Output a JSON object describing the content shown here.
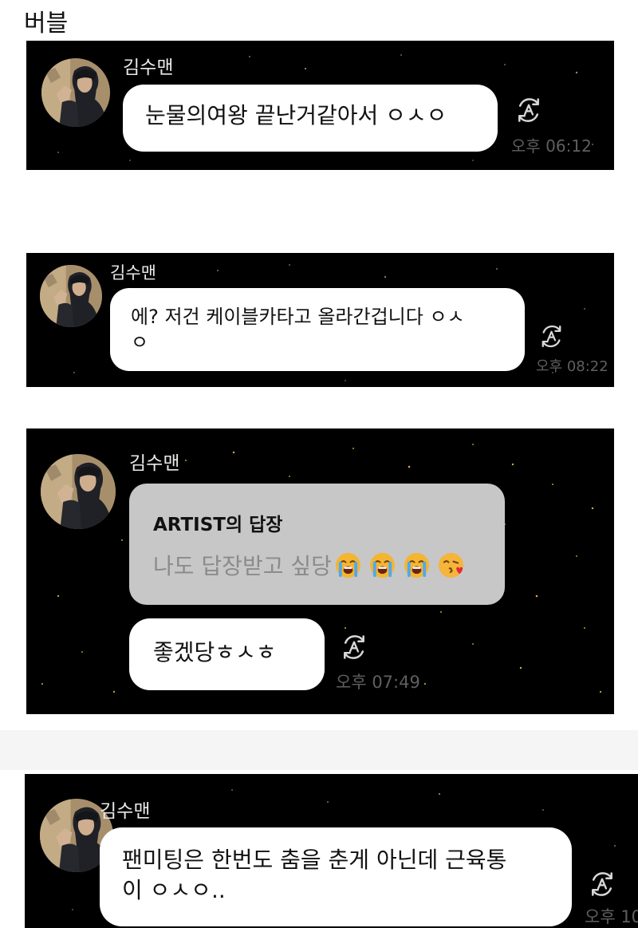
{
  "page": {
    "heading": "버블"
  },
  "messages": [
    {
      "sender": "김수맨",
      "text": "눈물의여왕 끝난거같아서 ㅇㅅㅇ",
      "time": "오후 06:12",
      "icon": "translate-icon"
    },
    {
      "sender": "김수맨",
      "text_line1": "에? 저건 케이블카타고 올라간겁니다 ㅇㅅ",
      "text_line2": "ㅇ",
      "time": "오후 08:22",
      "icon": "translate-icon"
    },
    {
      "sender": "김수맨",
      "reply_title": "ARTIST의 답장",
      "reply_text": "나도 답장받고 싶당",
      "reply_emojis": [
        "loudly-crying-face",
        "loudly-crying-face",
        "loudly-crying-face",
        "face-blowing-a-kiss"
      ],
      "text": "좋겠당ㅎㅅㅎ",
      "time": "오후 07:49",
      "icon": "translate-icon"
    },
    {
      "sender": "김수맨",
      "text_line1": "팬미팅은 한번도 춤을 춘게 아닌데 근육통",
      "text_line2": "이 ㅇㅅㅇ..",
      "time": "오후 10",
      "icon": "translate-icon"
    }
  ],
  "colors": {
    "panel_background": "#000000",
    "bubble": "#ffffff",
    "reply_box": "#c7c7c7",
    "timestamp": "#5f5f5f"
  }
}
